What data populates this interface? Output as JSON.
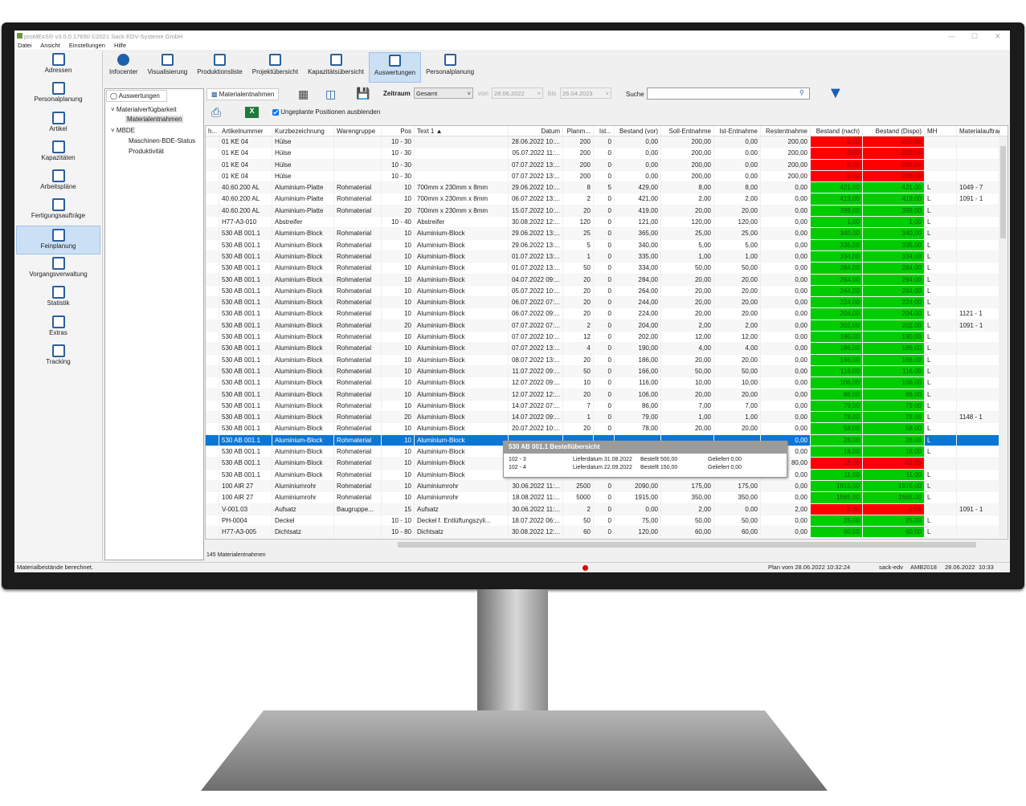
{
  "window": {
    "title": "proMExS® v3.0.0.17650 ©2021 Sack EDV-Systeme GmbH"
  },
  "menu": [
    "Datei",
    "Ansicht",
    "Einstellungen",
    "Hilfe"
  ],
  "sidebar": [
    {
      "label": "Adressen"
    },
    {
      "label": "Personalplanung"
    },
    {
      "label": "Artikel"
    },
    {
      "label": "Kapazitäten"
    },
    {
      "label": "Arbeitspläne"
    },
    {
      "label": "Fertigungsaufträge"
    },
    {
      "label": "Feinplanung",
      "active": true
    },
    {
      "label": "Vorgangsverwaltung"
    },
    {
      "label": "Statistik"
    },
    {
      "label": "Extras"
    },
    {
      "label": "Tracking"
    }
  ],
  "toolbar": [
    {
      "label": "Infocenter",
      "icon": "info-icon"
    },
    {
      "label": "Visualisierung",
      "icon": "visualization-icon"
    },
    {
      "label": "Produktionsliste",
      "icon": "list-icon"
    },
    {
      "label": "Projektübersicht",
      "icon": "project-list-icon"
    },
    {
      "label": "Kapazitätsübersicht",
      "icon": "capacity-list-icon"
    },
    {
      "label": "Auswertungen",
      "icon": "pie-chart-icon",
      "active": true
    },
    {
      "label": "Personalplanung",
      "icon": "calendar-people-icon"
    }
  ],
  "tree": {
    "tab": "Auswertungen",
    "nodes": [
      "Materialverfügbarkeit",
      "Materialentnahmen",
      "MBDE",
      "Maschinen-BDE-Status",
      "Produktivität"
    ]
  },
  "panel": {
    "tab": "Materialentnahmen",
    "zeitraum_label": "Zeitraum",
    "zeitraum_value": "Gesamt",
    "von_label": "von",
    "von_value": "28.06.2022",
    "bis_label": "bis",
    "bis_value": "26.04.2023",
    "search_label": "Suche",
    "search_value": "",
    "checkbox_label": "Ungeplante Positionen ausblenden",
    "checkbox_checked": true,
    "count": "145 Materialentnahmen"
  },
  "colors": {
    "accent": "#0a76d6",
    "negative": "#ff0000",
    "positive": "#00cc00"
  },
  "table": {
    "columns": [
      "h...",
      "Artikelnummer",
      "Kurzbezeichnung",
      "Warengruppe",
      "Pos",
      "Text 1 ▲",
      "Datum",
      "Planm...",
      "Ist...",
      "Bestand (vor)",
      "Soll-Entnahme",
      "Ist-Entnahme",
      "Restentnahme",
      "Bestand (nach)",
      "Bestand (Dispo)",
      "MH",
      "Materialauftrag"
    ],
    "rows": [
      [
        "",
        "01 KE 04",
        "Hülse",
        "",
        "10 - 30",
        "",
        "28.06.2022 10:...",
        "200",
        "0",
        "0,00",
        "200,00",
        "0,00",
        "200,00",
        "0,00",
        "-200,00",
        "",
        "",
        "red"
      ],
      [
        "",
        "01 KE 04",
        "Hülse",
        "",
        "10 - 30",
        "",
        "05.07.2022 11:...",
        "200",
        "0",
        "0,00",
        "200,00",
        "0,00",
        "200,00",
        "0,00",
        "-200,00",
        "",
        "",
        "red"
      ],
      [
        "",
        "01 KE 04",
        "Hülse",
        "",
        "10 - 30",
        "",
        "07.07.2022 13:...",
        "200",
        "0",
        "0,00",
        "200,00",
        "0,00",
        "200,00",
        "0,00",
        "-200,00",
        "",
        "",
        "red"
      ],
      [
        "",
        "01 KE 04",
        "Hülse",
        "",
        "10 - 30",
        "",
        "07.07.2022 13:...",
        "200",
        "0",
        "0,00",
        "200,00",
        "0,00",
        "200,00",
        "0,00",
        "-200,00",
        "",
        "",
        "red"
      ],
      [
        "",
        "40.60.200 AL",
        "Aluminium-Platte",
        "Rohmaterial",
        "10",
        "700mm x 230mm x 8mm",
        "29.06.2022 10:...",
        "8",
        "5",
        "429,00",
        "8,00",
        "8,00",
        "0,00",
        "421,00",
        "421,00",
        "L",
        "1049 - 7",
        "grn"
      ],
      [
        "",
        "40.60.200 AL",
        "Aluminium-Platte",
        "Rohmaterial",
        "10",
        "700mm x 230mm x 8mm",
        "06.07.2022 13:...",
        "2",
        "0",
        "421,00",
        "2,00",
        "2,00",
        "0,00",
        "419,00",
        "419,00",
        "L",
        "1091 - 1",
        "grn"
      ],
      [
        "",
        "40.60.200 AL",
        "Aluminium-Platte",
        "Rohmaterial",
        "20",
        "700mm x 230mm x 8mm",
        "15.07.2022 10:...",
        "20",
        "0",
        "419,00",
        "20,00",
        "20,00",
        "0,00",
        "399,00",
        "399,00",
        "L",
        "",
        "grn"
      ],
      [
        "",
        "H77-A3-010",
        "Abstreifer",
        "",
        "10 - 40",
        "Abstreifer",
        "30.08.2022 12:...",
        "120",
        "0",
        "121,00",
        "120,00",
        "120,00",
        "0,00",
        "1,00",
        "1,00",
        "L",
        "",
        "grn"
      ],
      [
        "",
        "530 AB 001.1",
        "Aluminium-Block",
        "Rohmaterial",
        "10",
        "Aluminium-Block",
        "29.06.2022 13:...",
        "25",
        "0",
        "365,00",
        "25,00",
        "25,00",
        "0,00",
        "340,00",
        "340,00",
        "L",
        "",
        "grn"
      ],
      [
        "",
        "530 AB 001.1",
        "Aluminium-Block",
        "Rohmaterial",
        "10",
        "Aluminium-Block",
        "29.06.2022 13:...",
        "5",
        "0",
        "340,00",
        "5,00",
        "5,00",
        "0,00",
        "335,00",
        "335,00",
        "L",
        "",
        "grn"
      ],
      [
        "",
        "530 AB 001.1",
        "Aluminium-Block",
        "Rohmaterial",
        "10",
        "Aluminium-Block",
        "01.07.2022 13:...",
        "1",
        "0",
        "335,00",
        "1,00",
        "1,00",
        "0,00",
        "334,00",
        "334,00",
        "L",
        "",
        "grn"
      ],
      [
        "",
        "530 AB 001.1",
        "Aluminium-Block",
        "Rohmaterial",
        "10",
        "Aluminium-Block",
        "01.07.2022 13:...",
        "50",
        "0",
        "334,00",
        "50,00",
        "50,00",
        "0,00",
        "284,00",
        "284,00",
        "L",
        "",
        "grn"
      ],
      [
        "",
        "530 AB 001.1",
        "Aluminium-Block",
        "Rohmaterial",
        "10",
        "Aluminium-Block",
        "04.07.2022 09:...",
        "20",
        "0",
        "284,00",
        "20,00",
        "20,00",
        "0,00",
        "264,00",
        "264,00",
        "L",
        "",
        "grn"
      ],
      [
        "",
        "530 AB 001.1",
        "Aluminium-Block",
        "Rohmaterial",
        "10",
        "Aluminium-Block",
        "05.07.2022 10:...",
        "20",
        "0",
        "264,00",
        "20,00",
        "20,00",
        "0,00",
        "244,00",
        "244,00",
        "L",
        "",
        "grn"
      ],
      [
        "",
        "530 AB 001.1",
        "Aluminium-Block",
        "Rohmaterial",
        "10",
        "Aluminium-Block",
        "06.07.2022 07:...",
        "20",
        "0",
        "244,00",
        "20,00",
        "20,00",
        "0,00",
        "224,00",
        "224,00",
        "L",
        "",
        "grn"
      ],
      [
        "",
        "530 AB 001.1",
        "Aluminium-Block",
        "Rohmaterial",
        "10",
        "Aluminium-Block",
        "06.07.2022 09:...",
        "20",
        "0",
        "224,00",
        "20,00",
        "20,00",
        "0,00",
        "204,00",
        "204,00",
        "L",
        "1121 - 1",
        "grn"
      ],
      [
        "",
        "530 AB 001.1",
        "Aluminium-Block",
        "Rohmaterial",
        "20",
        "Aluminium-Block",
        "07.07.2022 07:...",
        "2",
        "0",
        "204,00",
        "2,00",
        "2,00",
        "0,00",
        "202,00",
        "202,00",
        "L",
        "1091 - 1",
        "grn"
      ],
      [
        "",
        "530 AB 001.1",
        "Aluminium-Block",
        "Rohmaterial",
        "10",
        "Aluminium-Block",
        "07.07.2022 10:...",
        "12",
        "0",
        "202,00",
        "12,00",
        "12,00",
        "0,00",
        "190,00",
        "190,00",
        "L",
        "",
        "grn"
      ],
      [
        "",
        "530 AB 001.1",
        "Aluminium-Block",
        "Rohmaterial",
        "10",
        "Aluminium-Block",
        "07.07.2022 13:...",
        "4",
        "0",
        "190,00",
        "4,00",
        "4,00",
        "0,00",
        "186,00",
        "186,00",
        "L",
        "",
        "grn"
      ],
      [
        "",
        "530 AB 001.1",
        "Aluminium-Block",
        "Rohmaterial",
        "10",
        "Aluminium-Block",
        "08.07.2022 13:...",
        "20",
        "0",
        "186,00",
        "20,00",
        "20,00",
        "0,00",
        "166,00",
        "166,00",
        "L",
        "",
        "grn"
      ],
      [
        "",
        "530 AB 001.1",
        "Aluminium-Block",
        "Rohmaterial",
        "10",
        "Aluminium-Block",
        "11.07.2022 09:...",
        "50",
        "0",
        "166,00",
        "50,00",
        "50,00",
        "0,00",
        "116,00",
        "116,00",
        "L",
        "",
        "grn"
      ],
      [
        "",
        "530 AB 001.1",
        "Aluminium-Block",
        "Rohmaterial",
        "10",
        "Aluminium-Block",
        "12.07.2022 09:...",
        "10",
        "0",
        "116,00",
        "10,00",
        "10,00",
        "0,00",
        "106,00",
        "106,00",
        "L",
        "",
        "grn"
      ],
      [
        "",
        "530 AB 001.1",
        "Aluminium-Block",
        "Rohmaterial",
        "10",
        "Aluminium-Block",
        "12.07.2022 12:...",
        "20",
        "0",
        "106,00",
        "20,00",
        "20,00",
        "0,00",
        "86,00",
        "86,00",
        "L",
        "",
        "grn"
      ],
      [
        "",
        "530 AB 001.1",
        "Aluminium-Block",
        "Rohmaterial",
        "10",
        "Aluminium-Block",
        "14.07.2022 07:...",
        "7",
        "0",
        "86,00",
        "7,00",
        "7,00",
        "0,00",
        "79,00",
        "79,00",
        "L",
        "",
        "grn"
      ],
      [
        "",
        "530 AB 001.1",
        "Aluminium-Block",
        "Rohmaterial",
        "20",
        "Aluminium-Block",
        "14.07.2022 09:...",
        "1",
        "0",
        "79,00",
        "1,00",
        "1,00",
        "0,00",
        "78,00",
        "78,00",
        "L",
        "1148 - 1",
        "grn"
      ],
      [
        "",
        "530 AB 001.1",
        "Aluminium-Block",
        "Rohmaterial",
        "10",
        "Aluminium-Block",
        "20.07.2022 10:...",
        "20",
        "0",
        "78,00",
        "20,00",
        "20,00",
        "0,00",
        "58,00",
        "58,00",
        "L",
        "",
        "grn"
      ],
      [
        "",
        "530 AB 001.1",
        "Aluminium-Block",
        "Rohmaterial",
        "10",
        "Aluminium-Block",
        "",
        "",
        "",
        "",
        "",
        "",
        "0,00",
        "28,00",
        "28,00",
        "L",
        "",
        "grn",
        "sel"
      ],
      [
        "",
        "530 AB 001.1",
        "Aluminium-Block",
        "Rohmaterial",
        "10",
        "Aluminium-Block",
        "",
        "",
        "",
        "",
        "",
        "",
        "0,00",
        "18,00",
        "18,00",
        "L",
        "",
        "grn"
      ],
      [
        "",
        "530 AB 001.1",
        "Aluminium-Block",
        "Rohmaterial",
        "10",
        "Aluminium-Block",
        "",
        "",
        "",
        "",
        "",
        "",
        "80,00",
        "18,00",
        "-62,00",
        "",
        "",
        "red"
      ],
      [
        "",
        "530 AB 001.1",
        "Aluminium-Block",
        "Rohmaterial",
        "10",
        "Aluminium-Block",
        "",
        "",
        "",
        "",
        "",
        "",
        "0,00",
        "11,00",
        "11,00",
        "L",
        "",
        "grn"
      ],
      [
        "",
        "100 AlR 27",
        "Aluminiumrohr",
        "Rohmaterial",
        "10",
        "Aluminiumrohr",
        "30.06.2022 11:...",
        "2500",
        "0",
        "2090,00",
        "175,00",
        "175,00",
        "0,00",
        "1915,00",
        "1915,00",
        "L",
        "",
        "grn"
      ],
      [
        "",
        "100 AlR 27",
        "Aluminiumrohr",
        "Rohmaterial",
        "10",
        "Aluminiumrohr",
        "18.08.2022 11:...",
        "5000",
        "0",
        "1915,00",
        "350,00",
        "350,00",
        "0,00",
        "1565,00",
        "1565,00",
        "L",
        "",
        "grn"
      ],
      [
        "",
        "V-001.03",
        "Aufsatz",
        "Baugruppe...",
        "15",
        "Aufsatz",
        "30.06.2022 11:...",
        "2",
        "0",
        "0,00",
        "2,00",
        "0,00",
        "2,00",
        "0,00",
        "-2,00",
        "",
        "1091 - 1",
        "red"
      ],
      [
        "",
        "PH-0004",
        "Deckel",
        "",
        "10 - 10",
        "Deckel f. Entlüftungszyli...",
        "18.07.2022 06:...",
        "50",
        "0",
        "75,00",
        "50,00",
        "50,00",
        "0,00",
        "25,00",
        "25,00",
        "L",
        "",
        "grn"
      ],
      [
        "",
        "H77-A3-005",
        "Dichtsatz",
        "",
        "10 - 80",
        "Dichtsatz",
        "30.08.2022 12:...",
        "60",
        "0",
        "120,00",
        "60,00",
        "60,00",
        "0,00",
        "60,00",
        "60,00",
        "L",
        "",
        "grn"
      ]
    ]
  },
  "tooltip": {
    "title": "530 AB 001.1 Bestellübersicht",
    "lines": [
      [
        "102 - 3",
        "Lieferdatum 31.08.2022",
        "Bestellt 500,00",
        "Geliefert 0,00"
      ],
      [
        "102 - 4",
        "Lieferdatum 22.09.2022",
        "Bestellt 150,00",
        "Geliefert 0,00"
      ]
    ]
  },
  "status": {
    "message": "Materialbestände berechnet.",
    "plan": "Plan vom 28.06.2022 10:32:24",
    "user": "sack-edv",
    "db": "AMB2018",
    "date": "28.06.2022",
    "time": "10:33"
  }
}
